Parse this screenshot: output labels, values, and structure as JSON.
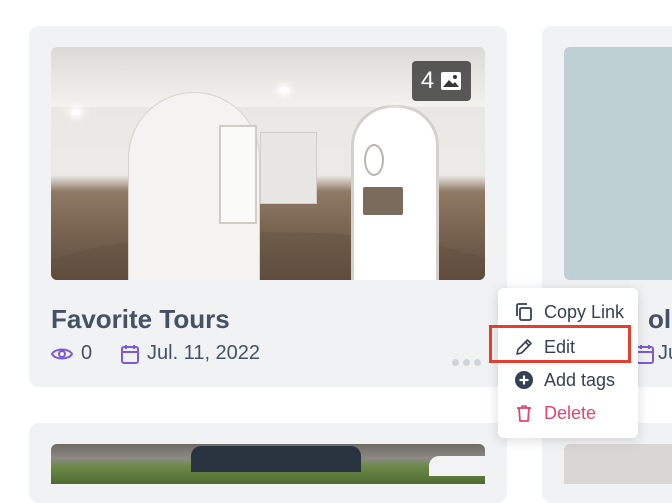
{
  "cards": {
    "main": {
      "title": "Favorite Tours",
      "views": "0",
      "date": "Jul. 11, 2022",
      "image_count": "4"
    },
    "right": {
      "title_partial": "olde",
      "date_partial": "Ju"
    }
  },
  "menu": {
    "items": [
      {
        "label": "Copy Link",
        "icon": "copy-icon"
      },
      {
        "label": "Edit",
        "icon": "pencil-icon"
      },
      {
        "label": "Add tags",
        "icon": "plus-circle-icon"
      },
      {
        "label": "Delete",
        "icon": "trash-icon"
      }
    ]
  },
  "colors": {
    "card_bg": "#f0f2f4",
    "text": "#445264",
    "accent_purple": "#7c5cd6",
    "delete_red": "#e0466e",
    "highlight_red": "#e2402f"
  }
}
